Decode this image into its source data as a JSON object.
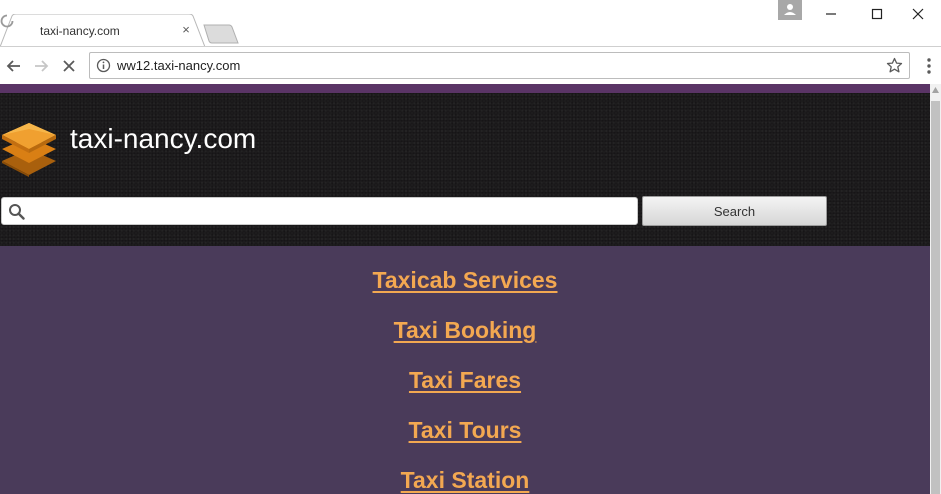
{
  "browser": {
    "tab_title": "taxi-nancy.com",
    "tab_close": "×",
    "url": "ww12.taxi-nancy.com"
  },
  "page": {
    "site_title": "taxi-nancy.com",
    "search": {
      "value": "",
      "placeholder": "",
      "button_label": "Search"
    },
    "links": [
      {
        "label": "Taxicab Services"
      },
      {
        "label": "Taxi Booking"
      },
      {
        "label": "Taxi Fares"
      },
      {
        "label": "Taxi Tours"
      },
      {
        "label": "Taxi Station"
      }
    ]
  },
  "colors": {
    "header_background": "#1d1c1d",
    "page_background": "#4a3b5a",
    "accent_strip": "#5a3466",
    "link": "#f3a851",
    "logo_orange": "#f0a030"
  },
  "icons": {
    "tab_spinner": "loading-spinner-icon",
    "back": "arrow-left-icon",
    "forward": "arrow-right-icon",
    "stop": "close-x-icon",
    "info": "info-circle-icon",
    "bookmark": "star-outline-icon",
    "menu": "three-dots-vertical-icon",
    "profile": "person-icon",
    "search": "magnifier-icon",
    "logo": "stacked-layers-icon"
  }
}
